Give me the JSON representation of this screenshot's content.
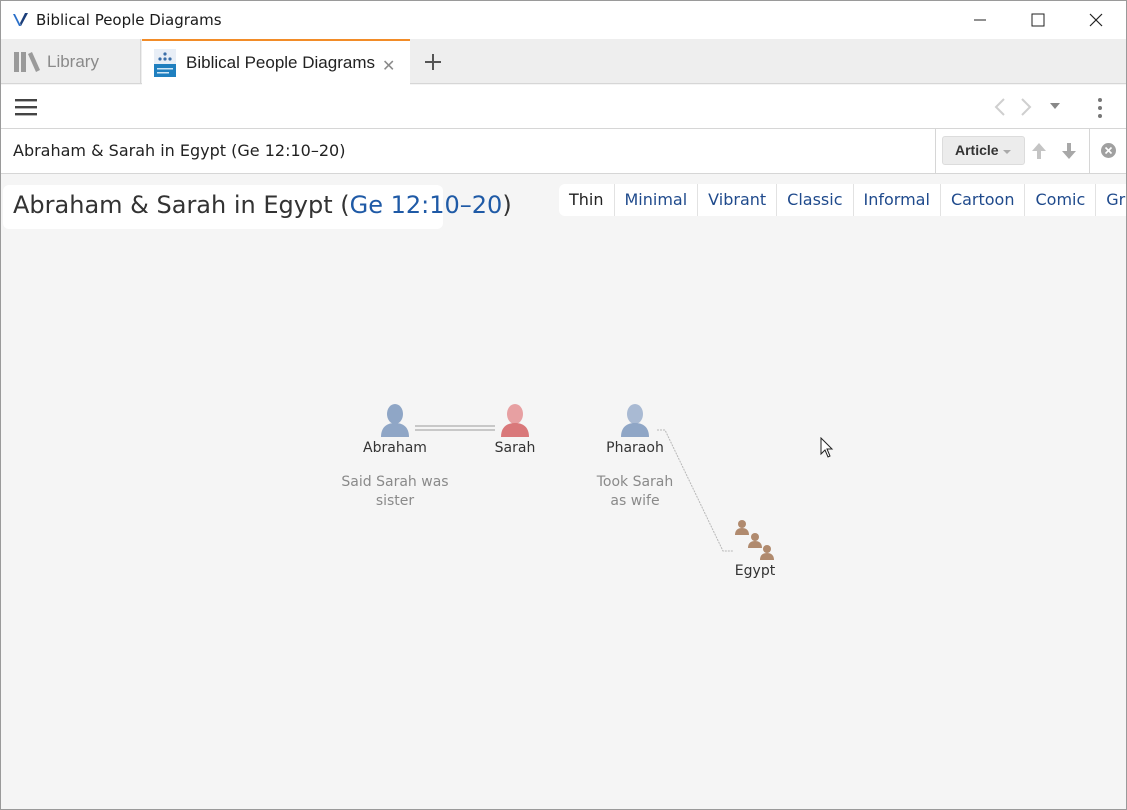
{
  "window": {
    "title": "Biblical People Diagrams"
  },
  "tabs": {
    "library_label": "Library",
    "active_label": "Biblical People Diagrams",
    "close_glyph": "✕",
    "add_icon": "plus-icon"
  },
  "toolbar": {
    "menu_icon": "hamburger-icon",
    "back_icon": "chevron-left-icon",
    "forward_icon": "chevron-right-icon",
    "history_icon": "caret-down-icon",
    "more_icon": "kebab-icon"
  },
  "refbar": {
    "input_value": "Abraham & Sarah in Egypt (Ge 12:10–20)",
    "article_label": "Article"
  },
  "diagram": {
    "title_text": "Abraham & Sarah in Egypt (",
    "title_ref": "Ge 12:10–20",
    "title_close": ")",
    "styles": [
      "Thin",
      "Minimal",
      "Vibrant",
      "Classic",
      "Informal",
      "Cartoon",
      "Comic",
      "Graffiti"
    ],
    "selected_style": "Thin",
    "people": {
      "abraham": {
        "name": "Abraham",
        "note": "Said Sarah was sister",
        "color": "#8fa6c6"
      },
      "sarah": {
        "name": "Sarah",
        "note": "",
        "color": "#d9787a"
      },
      "pharaoh": {
        "name": "Pharaoh",
        "note": "Took Sarah as wife",
        "color": "#8fa6c6"
      },
      "egypt": {
        "name": "Egypt",
        "note": "",
        "color": "#b08a6e"
      }
    }
  },
  "colors": {
    "accent_tab": "#f28c28",
    "link": "#1f5aa6",
    "background": "#f5f5f5"
  }
}
